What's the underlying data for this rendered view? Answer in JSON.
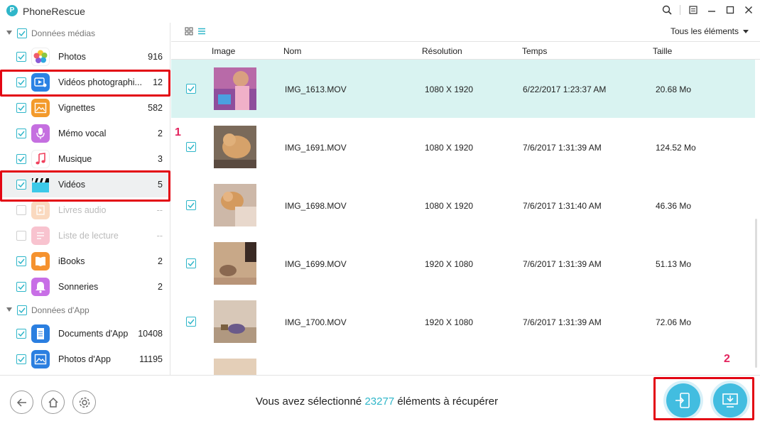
{
  "app": {
    "title": "PhoneRescue",
    "logo_letter": "P"
  },
  "sidebar": {
    "groups": [
      {
        "label": "Données médias"
      },
      {
        "label": "Données d'App"
      }
    ],
    "items": [
      {
        "label": "Photos",
        "count": "916",
        "icon": "photos-icon"
      },
      {
        "label": "Vidéos photographi...",
        "count": "12",
        "icon": "photo-videos-icon"
      },
      {
        "label": "Vignettes",
        "count": "582",
        "icon": "thumbnails-icon"
      },
      {
        "label": "Mémo vocal",
        "count": "2",
        "icon": "microphone-icon"
      },
      {
        "label": "Musique",
        "count": "3",
        "icon": "music-note-icon"
      },
      {
        "label": "Vidéos",
        "count": "5",
        "icon": "clapperboard-icon"
      },
      {
        "label": "Livres audio",
        "count": "--",
        "icon": "audiobook-icon"
      },
      {
        "label": "Liste de lecture",
        "count": "--",
        "icon": "playlist-icon"
      },
      {
        "label": "iBooks",
        "count": "2",
        "icon": "book-icon"
      },
      {
        "label": "Sonneries",
        "count": "2",
        "icon": "bell-icon"
      },
      {
        "label": "Documents d'App",
        "count": "10408",
        "icon": "document-icon"
      },
      {
        "label": "Photos d'App",
        "count": "11195",
        "icon": "image-icon"
      }
    ]
  },
  "toolbar": {
    "filter_label": "Tous les éléments"
  },
  "table": {
    "headers": {
      "image": "Image",
      "name": "Nom",
      "resolution": "Résolution",
      "time": "Temps",
      "size": "Taille"
    },
    "rows": [
      {
        "name": "IMG_1613.MOV",
        "resolution": "1080 X 1920",
        "time": "6/22/2017 1:23:37 AM",
        "size": "20.68 Mo"
      },
      {
        "name": "IMG_1691.MOV",
        "resolution": "1080 X 1920",
        "time": "7/6/2017 1:31:39 AM",
        "size": "124.52 Mo"
      },
      {
        "name": "IMG_1698.MOV",
        "resolution": "1080 X 1920",
        "time": "7/6/2017 1:31:40 AM",
        "size": "46.36 Mo"
      },
      {
        "name": "IMG_1699.MOV",
        "resolution": "1920 X 1080",
        "time": "7/6/2017 1:31:39 AM",
        "size": "51.13 Mo"
      },
      {
        "name": "IMG_1700.MOV",
        "resolution": "1920 X 1080",
        "time": "7/6/2017 1:31:39 AM",
        "size": "72.06 Mo"
      }
    ]
  },
  "annotations": {
    "step1": "1",
    "step2": "2"
  },
  "footer": {
    "status_prefix": "Vous avez sélectionné",
    "selected_count": "23277",
    "status_suffix": "éléments à récupérer"
  },
  "colors": {
    "accent": "#2fb6c9",
    "highlight_row": "#d9f3f1",
    "annotation_box": "#e30613",
    "annotation_number": "#e3245e"
  }
}
